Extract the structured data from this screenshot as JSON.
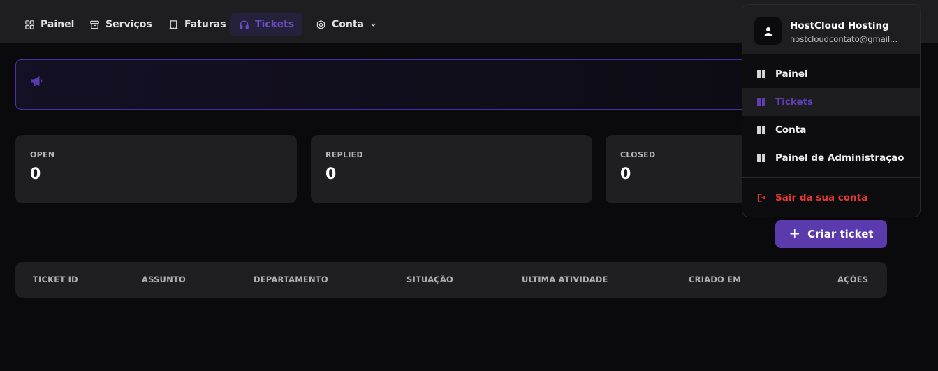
{
  "nav": {
    "items": [
      {
        "label": "Painel",
        "icon": "grid-icon"
      },
      {
        "label": "Serviços",
        "icon": "archive-icon"
      },
      {
        "label": "Faturas",
        "icon": "receipt-icon"
      },
      {
        "label": "Tickets",
        "icon": "headset-icon",
        "active": true
      },
      {
        "label": "Conta",
        "icon": "gear-icon",
        "has_dropdown": true
      }
    ]
  },
  "banner": {
    "icon": "megaphone-icon",
    "text": ""
  },
  "stats": [
    {
      "label": "OPEN",
      "value": "0"
    },
    {
      "label": "REPLIED",
      "value": "0"
    },
    {
      "label": "CLOSED",
      "value": "0"
    }
  ],
  "create_button": {
    "label": "Criar ticket",
    "icon": "plus-icon"
  },
  "table": {
    "columns": [
      "TICKET ID",
      "ASSUNTO",
      "DEPARTAMENTO",
      "SITUAÇÃO",
      "ÚLTIMA ATIVIDADE",
      "CRIADO EM",
      "AÇÕES"
    ],
    "rows": []
  },
  "user_menu": {
    "name": "HostCloud Hosting",
    "email": "hostcloudcontato@gmail...",
    "items": [
      {
        "label": "Painel",
        "icon": "dashboard-icon"
      },
      {
        "label": "Tickets",
        "icon": "dashboard-icon",
        "active": true
      },
      {
        "label": "Conta",
        "icon": "dashboard-icon"
      },
      {
        "label": "Painel de Administração",
        "icon": "dashboard-icon"
      }
    ],
    "logout": {
      "label": "Sair da sua conta",
      "icon": "logout-icon"
    }
  },
  "colors": {
    "accent": "#5a3aac",
    "accent_text": "#6b4bc4",
    "danger": "#e53935",
    "background": "#0a090c",
    "card": "#1f1e21"
  }
}
